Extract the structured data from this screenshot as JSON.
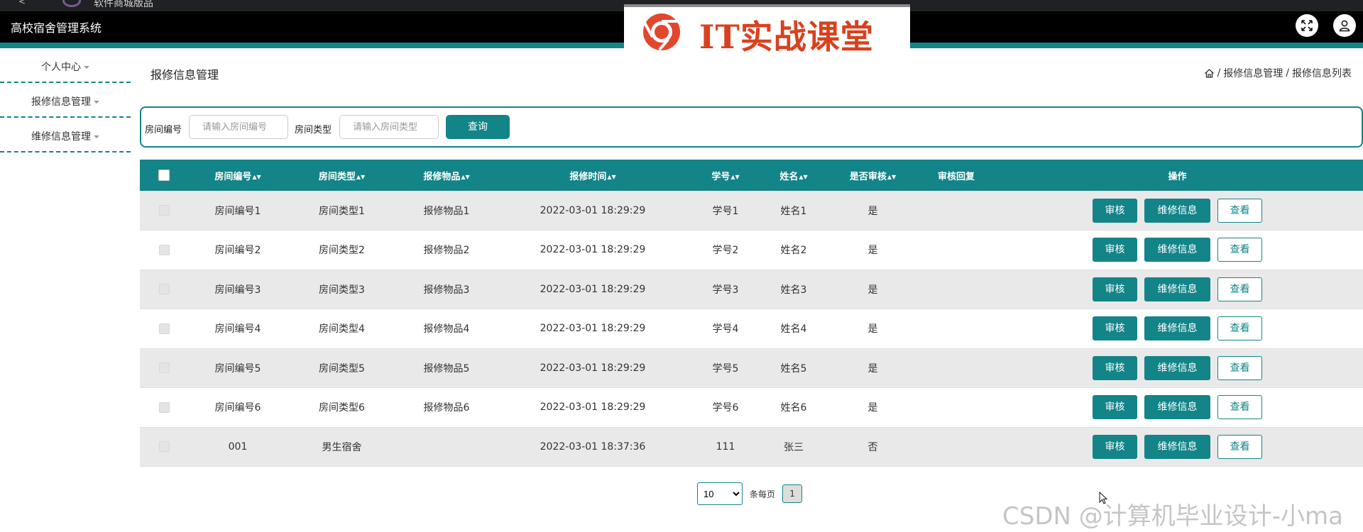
{
  "browser": {
    "tab_title": "软件商城版品"
  },
  "header": {
    "title": "高校宿舍管理系统",
    "logo_text": "IT实战课堂"
  },
  "sidebar": {
    "items": [
      {
        "label": "个人中心"
      },
      {
        "label": "报修信息管理"
      },
      {
        "label": "维修信息管理"
      }
    ]
  },
  "page": {
    "heading": "报修信息管理",
    "breadcrumb": [
      "报修信息管理",
      "报修信息列表"
    ],
    "breadcrumb_sep": "/"
  },
  "search": {
    "room_no_label": "房间编号",
    "room_no_placeholder": "请输入房间编号",
    "room_type_label": "房间类型",
    "room_type_placeholder": "请输入房间类型",
    "button_label": "查询"
  },
  "table": {
    "headers": [
      "房间编号",
      "房间类型",
      "报修物品",
      "报修时间",
      "学号",
      "姓名",
      "是否审核",
      "审核回复",
      "操作"
    ],
    "rows": [
      {
        "room_no": "房间编号1",
        "room_type": "房间类型1",
        "item": "报修物品1",
        "time": "2022-03-01 18:29:29",
        "student_no": "学号1",
        "name": "姓名1",
        "audited": "是",
        "reply": ""
      },
      {
        "room_no": "房间编号2",
        "room_type": "房间类型2",
        "item": "报修物品2",
        "time": "2022-03-01 18:29:29",
        "student_no": "学号2",
        "name": "姓名2",
        "audited": "是",
        "reply": ""
      },
      {
        "room_no": "房间编号3",
        "room_type": "房间类型3",
        "item": "报修物品3",
        "time": "2022-03-01 18:29:29",
        "student_no": "学号3",
        "name": "姓名3",
        "audited": "是",
        "reply": ""
      },
      {
        "room_no": "房间编号4",
        "room_type": "房间类型4",
        "item": "报修物品4",
        "time": "2022-03-01 18:29:29",
        "student_no": "学号4",
        "name": "姓名4",
        "audited": "是",
        "reply": ""
      },
      {
        "room_no": "房间编号5",
        "room_type": "房间类型5",
        "item": "报修物品5",
        "time": "2022-03-01 18:29:29",
        "student_no": "学号5",
        "name": "姓名5",
        "audited": "是",
        "reply": ""
      },
      {
        "room_no": "房间编号6",
        "room_type": "房间类型6",
        "item": "报修物品6",
        "time": "2022-03-01 18:29:29",
        "student_no": "学号6",
        "name": "姓名6",
        "audited": "是",
        "reply": ""
      },
      {
        "room_no": "001",
        "room_type": "男生宿舍",
        "item": "",
        "time": "2022-03-01 18:37:36",
        "student_no": "111",
        "name": "张三",
        "audited": "否",
        "reply": ""
      }
    ],
    "actions": {
      "audit": "审核",
      "repair": "维修信息",
      "view": "查看"
    }
  },
  "pagination": {
    "page_size": "10",
    "page_size_options": [
      "10"
    ],
    "per_page_label": "条每页",
    "current_page": "1"
  },
  "watermark": "CSDN @计算机毕业设计-小ma",
  "colors": {
    "accent": "#138488",
    "topbar": "#000000",
    "row_alt": "#e9e9e9"
  },
  "icons": [
    "back-icon",
    "browser-favicon-icon",
    "chrome-logo-icon",
    "fullscreen-icon",
    "user-icon",
    "home-icon",
    "caret-down-icon",
    "sort-icon",
    "cursor-icon"
  ]
}
